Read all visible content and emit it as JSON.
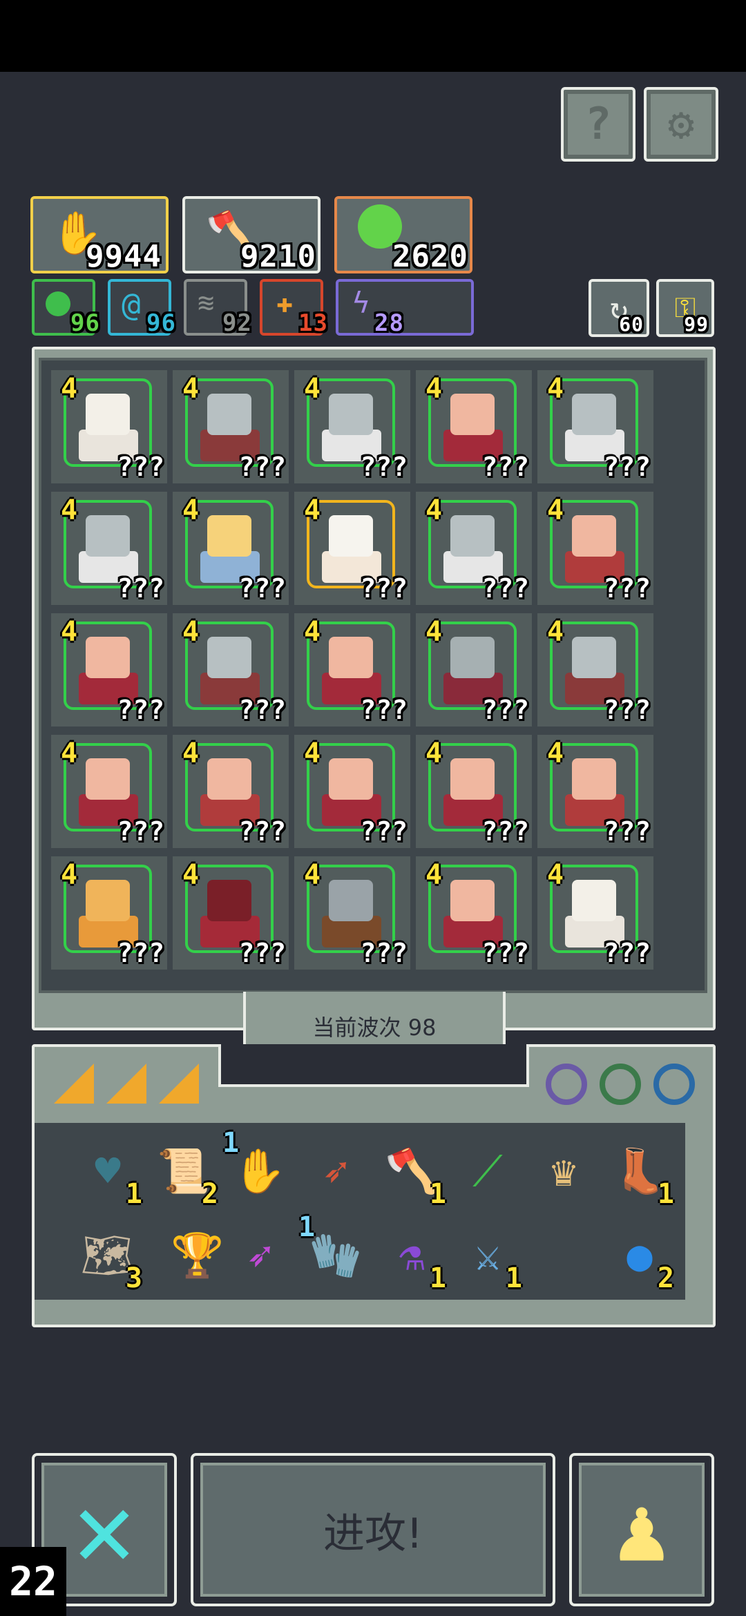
{
  "resources": {
    "main": [
      {
        "name": "food",
        "value": "9944",
        "color": "#f2d04a",
        "icon": "hand-icon"
      },
      {
        "name": "weapon",
        "value": "9210",
        "color": "#e9ece6",
        "icon": "axe-icon"
      },
      {
        "name": "gem",
        "value": "2620",
        "color": "#e6884a",
        "icon": "slime-icon"
      }
    ],
    "elements": [
      {
        "name": "nature",
        "value": "96",
        "color": "#3fbe4c"
      },
      {
        "name": "water",
        "value": "96",
        "color": "#34b7d6"
      },
      {
        "name": "wind",
        "value": "92",
        "color": "#8a8f8c"
      },
      {
        "name": "fire",
        "value": "13",
        "color": "#d6462c"
      },
      {
        "name": "thunder",
        "value": "28",
        "color": "#7a6ad6"
      }
    ],
    "refresh": "60",
    "key": "99"
  },
  "heroes": [
    {
      "level": "4",
      "label": "???",
      "type": "wizard",
      "border": "green"
    },
    {
      "level": "4",
      "label": "???",
      "type": "shield",
      "border": "green"
    },
    {
      "level": "4",
      "label": "???",
      "type": "knight",
      "border": "green"
    },
    {
      "level": "4",
      "label": "???",
      "type": "spear",
      "border": "green"
    },
    {
      "level": "4",
      "label": "???",
      "type": "knight",
      "border": "green"
    },
    {
      "level": "4",
      "label": "???",
      "type": "knight",
      "border": "green"
    },
    {
      "level": "4",
      "label": "???",
      "type": "blonde",
      "border": "green"
    },
    {
      "level": "4",
      "label": "???",
      "type": "priestess",
      "border": "gold"
    },
    {
      "level": "4",
      "label": "???",
      "type": "knight",
      "border": "green"
    },
    {
      "level": "4",
      "label": "???",
      "type": "crossbow",
      "border": "green"
    },
    {
      "level": "4",
      "label": "???",
      "type": "king",
      "border": "green"
    },
    {
      "level": "4",
      "label": "???",
      "type": "shield",
      "border": "green"
    },
    {
      "level": "4",
      "label": "???",
      "type": "spear",
      "border": "green"
    },
    {
      "level": "4",
      "label": "???",
      "type": "rogue",
      "border": "green"
    },
    {
      "level": "4",
      "label": "???",
      "type": "shield",
      "border": "green"
    },
    {
      "level": "4",
      "label": "???",
      "type": "spear",
      "border": "green"
    },
    {
      "level": "4",
      "label": "???",
      "type": "crossbow",
      "border": "green"
    },
    {
      "level": "4",
      "label": "???",
      "type": "spear",
      "border": "green"
    },
    {
      "level": "4",
      "label": "???",
      "type": "spear",
      "border": "green"
    },
    {
      "level": "4",
      "label": "???",
      "type": "crossbow",
      "border": "green"
    },
    {
      "level": "4",
      "label": "???",
      "type": "golem",
      "border": "green"
    },
    {
      "level": "4",
      "label": "???",
      "type": "mage",
      "border": "green"
    },
    {
      "level": "4",
      "label": "???",
      "type": "armor",
      "border": "green"
    },
    {
      "level": "4",
      "label": "???",
      "type": "spear",
      "border": "green"
    },
    {
      "level": "4",
      "label": "???",
      "type": "wizard",
      "border": "green"
    }
  ],
  "wave_label": "当前波次 98",
  "items_row1": [
    {
      "icon": "heart-shield-icon",
      "count": "1"
    },
    {
      "icon": "scroll-icon",
      "count": "2"
    },
    {
      "icon": "eye-hand-icon",
      "count": "1",
      "count_pos": "tl"
    },
    {
      "icon": "arrow-icon",
      "count": ""
    },
    {
      "icon": "axe-icon",
      "count": "1"
    },
    {
      "icon": "spear-icon",
      "count": ""
    },
    {
      "icon": "crown-icon",
      "count": ""
    },
    {
      "icon": "boot-icon",
      "count": "1"
    }
  ],
  "items_row2": [
    {
      "icon": "map-icon",
      "count": "3"
    },
    {
      "icon": "chalice-icon",
      "count": ""
    },
    {
      "icon": "magic-arrow-icon",
      "count": ""
    },
    {
      "icon": "gauntlet-icon",
      "count": "1",
      "count_pos": "tl"
    },
    {
      "icon": "potion-icon",
      "count": "1"
    },
    {
      "icon": "crossbow-icon",
      "count": "1"
    },
    {
      "icon": "orb-icon",
      "count": "2"
    }
  ],
  "attack_label": "进攻!",
  "wave_counter": "22"
}
